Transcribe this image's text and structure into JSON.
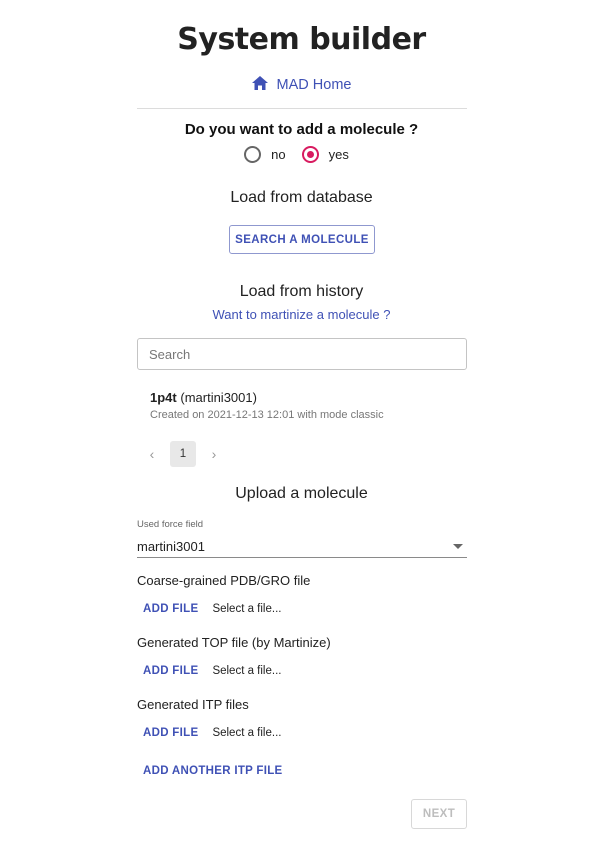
{
  "header": {
    "title": "System builder",
    "home_link": "MAD Home"
  },
  "question": {
    "text": "Do you want to add a molecule ?",
    "options": [
      {
        "label": "no",
        "selected": false
      },
      {
        "label": "yes",
        "selected": true
      }
    ]
  },
  "database": {
    "title": "Load from database",
    "button": "SEARCH A MOLECULE"
  },
  "history": {
    "title": "Load from history",
    "martinize_link": "Want to martinize a molecule ?",
    "search_placeholder": "Search",
    "items": [
      {
        "name": "1p4t",
        "forcefield": "(martini3001)",
        "subtitle": "Created on 2021-12-13 12:01 with mode classic"
      }
    ],
    "pagination": {
      "prev": "‹",
      "page": "1",
      "next": "›"
    }
  },
  "upload": {
    "title": "Upload a molecule",
    "forcefield_label": "Used force field",
    "forcefield_value": "martini3001",
    "files": [
      {
        "label": "Coarse-grained PDB/GRO file",
        "button": "ADD FILE",
        "status": "Select a file..."
      },
      {
        "label": "Generated TOP file (by Martinize)",
        "button": "ADD FILE",
        "status": "Select a file..."
      },
      {
        "label": "Generated ITP files",
        "button": "ADD FILE",
        "status": "Select a file..."
      }
    ],
    "add_itp_button": "ADD ANOTHER ITP FILE",
    "next_button": "NEXT"
  },
  "colors": {
    "accent": "#3f51b5",
    "radio_selected": "#d81b60"
  },
  "icons": {
    "home": "home-icon"
  }
}
